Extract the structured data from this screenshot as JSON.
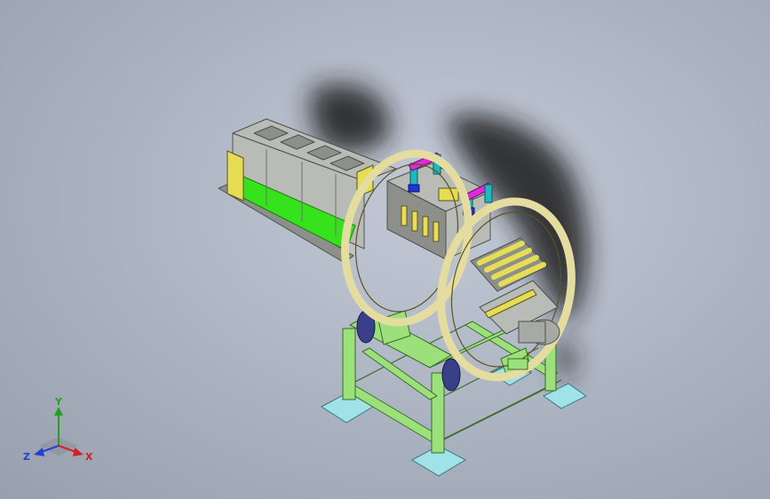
{
  "viewport": {
    "background": "#aab2c0"
  },
  "model": {
    "colors": {
      "frame": "#9be07a",
      "frame_edge": "#3c6a2a",
      "ring": "#e5dca0",
      "ring_edge": "#5a5420",
      "housing": "#b9bbb6",
      "housing_dark": "#8d908a",
      "guard": "#e6dd55",
      "belt": "#36e21c",
      "pad": "#9fe3e8",
      "cylinder_rod": "#1fb8c0",
      "cylinder_cap": "#e02ad8",
      "fitting": "#2430d8",
      "shadow": "#1e1e1e",
      "motor": "#a6a9a4"
    }
  },
  "triad": {
    "labels": {
      "x": "X",
      "y": "Y",
      "z": "Z"
    },
    "colors": {
      "x": "#d42020",
      "y": "#22a022",
      "z": "#2340d0"
    }
  }
}
